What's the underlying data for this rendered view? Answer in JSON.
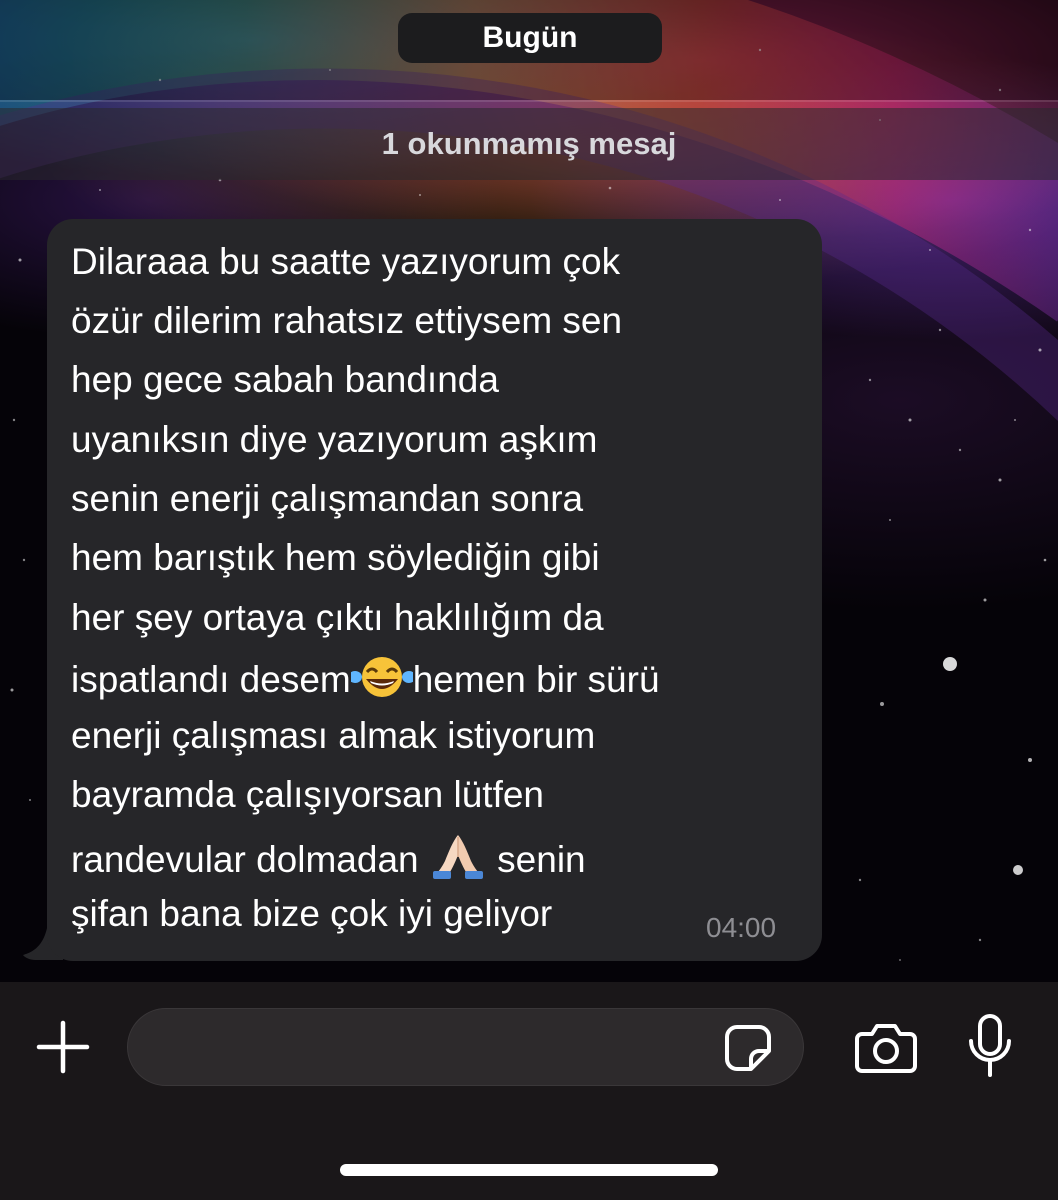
{
  "date_separator": "Bugün",
  "unread_banner": "1 okunmamış mesaj",
  "message": {
    "lines": [
      "Dilaraaa bu saatte yazıyorum çok",
      "özür dilerim rahatsız ettiysem sen",
      "hep gece sabah bandında",
      "uyanıksın diye yazıyorum aşkım",
      "senin enerji çalışmandan sonra",
      "hem barıştık hem söylediğin gibi",
      "her şey ortaya çıktı haklılığım da"
    ],
    "line_8_before": "ispatlandı desem",
    "line_8_after": "hemen bir sürü",
    "line_9": "enerji çalışması almak istiyorum",
    "line_10": "bayramda çalışıyorsan lütfen",
    "line_11_before": "randevular dolmadan ",
    "line_11_after": " senin",
    "line_12": "şifan bana bize çok iyi geliyor",
    "time": "04:00",
    "emojis": [
      "face-with-tears-of-joy-icon",
      "folded-hands-icon"
    ]
  },
  "composer": {
    "input_value": "",
    "input_placeholder": ""
  },
  "icons": {
    "add": "plus-icon",
    "sticker": "sticker-icon",
    "camera": "camera-icon",
    "mic": "microphone-icon"
  },
  "colors": {
    "bubble": "#262629",
    "composer_bg": "#1a1719",
    "timestamp": "#8e8e93",
    "date_pill": "#1c1c1e"
  }
}
